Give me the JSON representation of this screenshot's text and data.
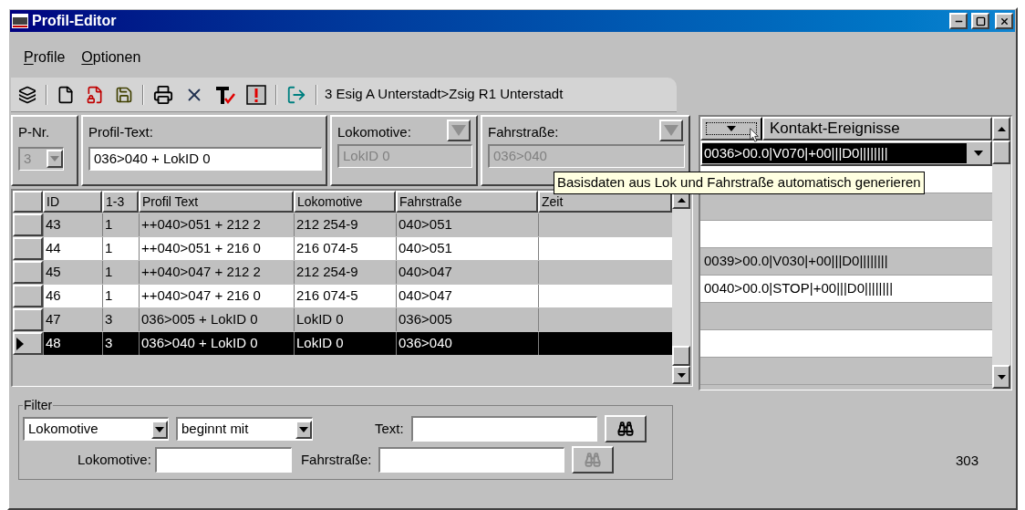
{
  "window": {
    "title": "Profil-Editor"
  },
  "menu": [
    {
      "label": "Profile"
    },
    {
      "label": "Optionen"
    }
  ],
  "toolbar": {
    "status_text": "3 Esig A Unterstadt>Zsig R1 Unterstadt"
  },
  "fields": {
    "p_nr": {
      "label": "P-Nr.",
      "value": "3",
      "disabled": true
    },
    "profil_text": {
      "label": "Profil-Text:",
      "value": "036>040 + LokID 0",
      "disabled": false
    },
    "lokomotive": {
      "label": "Lokomotive:",
      "value": "LokID 0",
      "disabled": true
    },
    "fahrstrasse": {
      "label": "Fahrstraße:",
      "value": "036>040",
      "disabled": true
    }
  },
  "table": {
    "columns": [
      "ID",
      "1-3",
      "Profil Text",
      "Lokomotive",
      "Fahrstraße",
      "Zeit"
    ],
    "rows": [
      {
        "cells": [
          "43",
          "1",
          "++040>051 + 212 2",
          "212 254-9",
          "040>051"
        ],
        "selected": false
      },
      {
        "cells": [
          "44",
          "1",
          "++040>051 + 216 0",
          "216 074-5",
          "040>051"
        ],
        "selected": false
      },
      {
        "cells": [
          "45",
          "1",
          "++040>047 + 212 2",
          "212 254-9",
          "040>047"
        ],
        "selected": false
      },
      {
        "cells": [
          "46",
          "1",
          "++040>047 + 216 0",
          "216 074-5",
          "040>047"
        ],
        "selected": false
      },
      {
        "cells": [
          "47",
          "3",
          "036>005 + LokID 0",
          "LokID 0",
          "036>005"
        ],
        "selected": false
      },
      {
        "cells": [
          "48",
          "3",
          "036>040 + LokID 0",
          "LokID 0",
          "036>040"
        ],
        "selected": true
      }
    ]
  },
  "events": {
    "title": "Kontakt-Ereignisse",
    "current": "0036>00.0|V070|+00|||D0||||||||",
    "rows": [
      {
        "kind": "empty"
      },
      {
        "kind": "empty"
      },
      {
        "kind": "empty"
      },
      {
        "kind": "entry",
        "text": "0039>00.0|V030|+00|||D0||||||||"
      },
      {
        "kind": "entry",
        "text": "0040>00.0|STOP|+00|||D0||||||||"
      },
      {
        "kind": "empty"
      },
      {
        "kind": "empty"
      },
      {
        "kind": "empty"
      }
    ]
  },
  "tooltip": "Basisdaten aus Lok und Fahrstraße automatisch generieren",
  "filter": {
    "legend": "Filter",
    "field": "Lokomotive",
    "mode": "beginnt mit",
    "text_label": "Text:",
    "lok_label": "Lokomotive:",
    "fahr_label": "Fahrstraße:",
    "search_disabled": false,
    "search2_disabled": true
  },
  "count": "303"
}
